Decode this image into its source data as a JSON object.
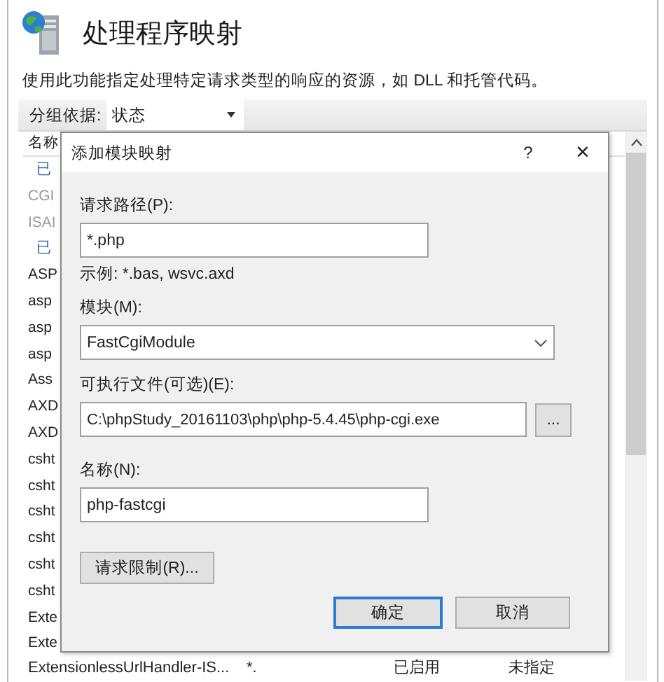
{
  "header": {
    "title": "处理程序映射",
    "description": "使用此功能指定处理特定请求类型的响应的资源，如 DLL 和托管代码。"
  },
  "toolbar": {
    "group_by_label": "分组依据:",
    "group_by_value": "状态"
  },
  "list": {
    "column_header": "名称",
    "rows": [
      {
        "kind": "group",
        "text": "已"
      },
      {
        "kind": "item",
        "text": "CGI",
        "disabled": true
      },
      {
        "kind": "item",
        "text": "ISAI",
        "disabled": true
      },
      {
        "kind": "group",
        "text": "已"
      },
      {
        "kind": "item",
        "text": "ASP",
        "disabled": false
      },
      {
        "kind": "item",
        "text": "asp",
        "disabled": false
      },
      {
        "kind": "item",
        "text": "asp",
        "disabled": false
      },
      {
        "kind": "item",
        "text": "asp",
        "disabled": false
      },
      {
        "kind": "item",
        "text": "Ass",
        "disabled": false
      },
      {
        "kind": "item",
        "text": "AXD",
        "disabled": false
      },
      {
        "kind": "item",
        "text": "AXD",
        "disabled": false
      },
      {
        "kind": "item",
        "text": "csht",
        "disabled": false
      },
      {
        "kind": "item",
        "text": "csht",
        "disabled": false
      },
      {
        "kind": "item",
        "text": "csht",
        "disabled": false
      },
      {
        "kind": "item",
        "text": "csht",
        "disabled": false
      },
      {
        "kind": "item",
        "text": "csht",
        "disabled": false
      },
      {
        "kind": "item",
        "text": "csht",
        "disabled": false
      },
      {
        "kind": "item",
        "text": "Exte",
        "disabled": false
      },
      {
        "kind": "item",
        "text": "Exte",
        "disabled": false
      }
    ],
    "last_row": {
      "name": "ExtensionlessUrlHandler-IS...",
      "path": "*.",
      "state": "已启用",
      "handler": "未指定"
    }
  },
  "dialog": {
    "title": "添加模块映射",
    "help": "?",
    "close": "×",
    "request_path": {
      "label": "请求路径(P):",
      "value": "*.php",
      "example": "示例: *.bas, wsvc.axd"
    },
    "module": {
      "label": "模块(M):",
      "value": "FastCgiModule"
    },
    "executable": {
      "label": "可执行文件(可选)(E):",
      "value": "C:\\phpStudy_20161103\\php\\php-5.4.45\\php-cgi.exe",
      "browse": "..."
    },
    "name": {
      "label": "名称(N):",
      "value": "php-fastcgi"
    },
    "restrictions_button": "请求限制(R)...",
    "ok_button": "确定",
    "cancel_button": "取消"
  }
}
